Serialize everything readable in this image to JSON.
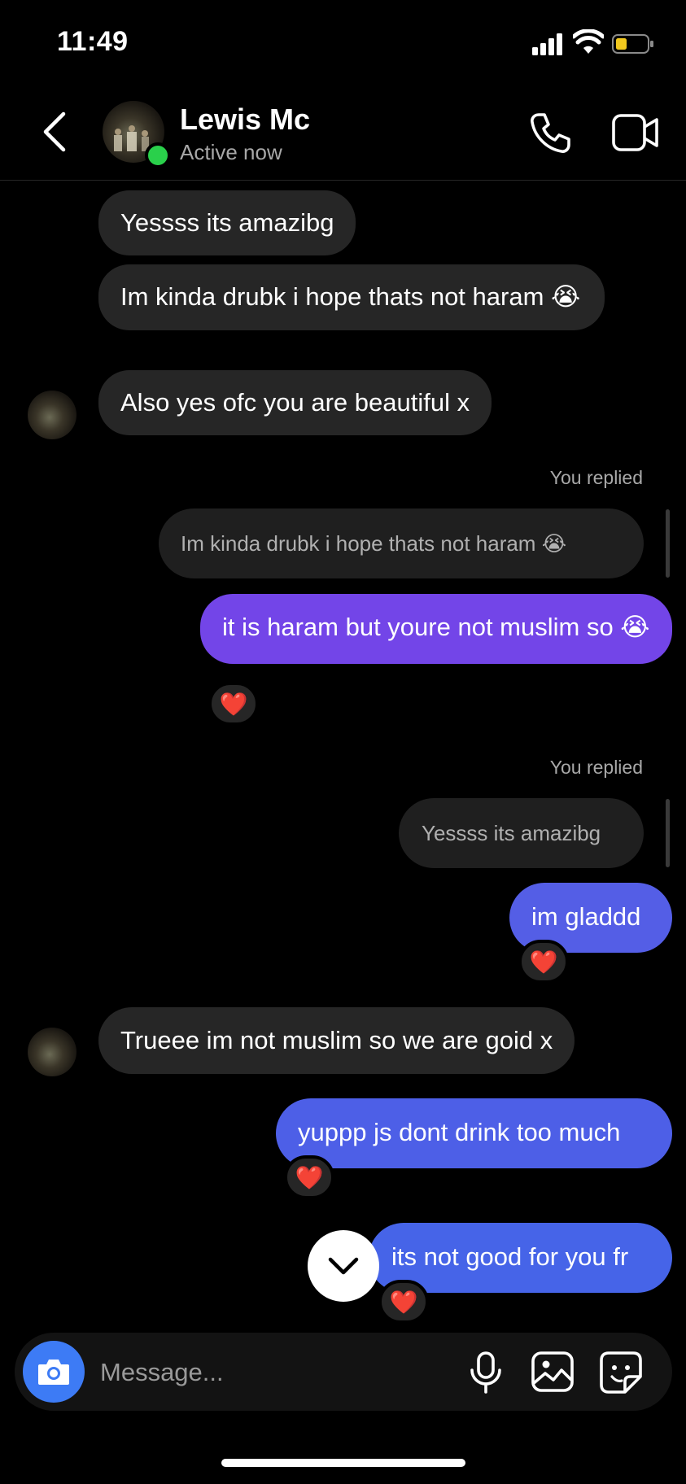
{
  "status_bar": {
    "time": "11:49"
  },
  "header": {
    "contact_name": "Lewis Mc",
    "status": "Active now"
  },
  "messages": [
    {
      "text": "Yessss its amazibg"
    },
    {
      "text": "Im kinda drubk i hope thats not haram 😭"
    },
    {
      "text": "Also yes ofc you are beautiful x"
    },
    {
      "replied_label": "You replied",
      "quoted": "Im kinda drubk i hope thats not haram 😭",
      "text": "it is haram but youre not muslim so 😭",
      "reaction": "❤️"
    },
    {
      "replied_label": "You replied",
      "quoted": "Yessss its amazibg",
      "text": "im gladdd",
      "reaction": "❤️"
    },
    {
      "text": "Trueee im not muslim so we are goid x"
    },
    {
      "text": "yuppp js dont drink too much",
      "reaction": "❤️"
    },
    {
      "text": "its not good for you fr",
      "reaction": "❤️"
    }
  ],
  "composer": {
    "placeholder": "Message..."
  },
  "colors": {
    "outgoing_purple": "#7345e8",
    "outgoing_blue": "#4a5ee8",
    "incoming": "#262626",
    "online": "#2ad04b",
    "camera": "#3d7bf5"
  }
}
